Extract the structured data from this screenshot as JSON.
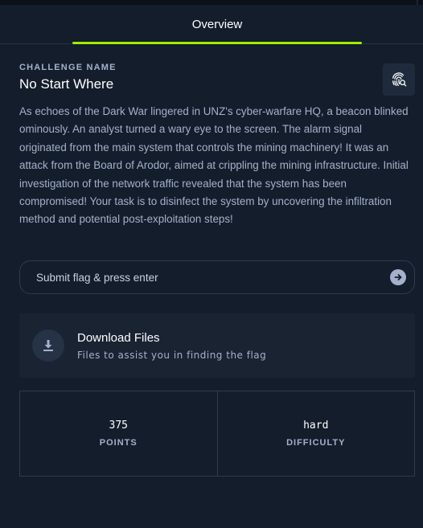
{
  "tabs": {
    "active_label": "Overview"
  },
  "challenge": {
    "label": "CHALLENGE NAME",
    "name": "No Start Where",
    "description": "As echoes of the Dark War lingered in UNZ's cyber-warfare HQ, a beacon blinked ominously. An analyst turned a wary eye to the screen. The alarm signal originated from the main system that controls the mining machinery! It was an attack from the Board of Arodor, aimed at crippling the mining infrastructure. Initial investigation of the network traffic revealed that the system has been compromised! Your task is to disinfect the system by uncovering the infiltration method and potential post-exploitation steps!"
  },
  "flag": {
    "placeholder": "Submit flag & press enter",
    "value": ""
  },
  "download": {
    "title": "Download Files",
    "subtitle": "Files to assist you in finding the flag"
  },
  "stats": {
    "points_value": "375",
    "points_label": "POINTS",
    "difficulty_value": "hard",
    "difficulty_label": "DIFFICULTY"
  },
  "icons": {
    "hint": "fingerprint-search-icon",
    "submit": "arrow-right-circle-icon",
    "download": "download-icon"
  },
  "colors": {
    "background": "#141d2b",
    "accent": "#9fef00",
    "card": "#1a2332",
    "text_primary": "#ffffff",
    "text_secondary": "#a4b1cd"
  }
}
